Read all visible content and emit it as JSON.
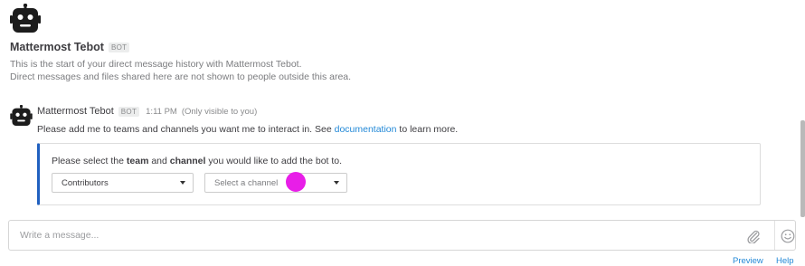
{
  "intro": {
    "bot_name": "Mattermost Tebot",
    "bot_tag": "BOT",
    "line1": "This is the start of your direct message history with Mattermost Tebot.",
    "line2": "Direct messages and files shared here are not shown to people outside this area."
  },
  "post": {
    "author": "Mattermost Tebot",
    "bot_tag": "BOT",
    "time": "1:11 PM",
    "visibility": "(Only visible to you)",
    "message_before": "Please add me to teams and channels you want me to interact in. See ",
    "message_link": "documentation",
    "message_after": " to learn more."
  },
  "attachment": {
    "text_pre": "Please select the ",
    "text_team": "team",
    "text_mid": " and ",
    "text_channel": "channel",
    "text_post": " you would like to add the bot to.",
    "team_select": "Contributors",
    "channel_select": "Select a channel",
    "accent_color": "#2060c0"
  },
  "composer": {
    "placeholder": "Write a message..."
  },
  "footer": {
    "preview": "Preview",
    "help": "Help"
  },
  "colors": {
    "link": "#2389d7",
    "cursor_marker": "#e81ee8"
  },
  "icons": {
    "avatar": "robot-icon",
    "attach": "paperclip-icon",
    "emoji": "smiley-icon",
    "dropdown": "caret-down-icon"
  }
}
